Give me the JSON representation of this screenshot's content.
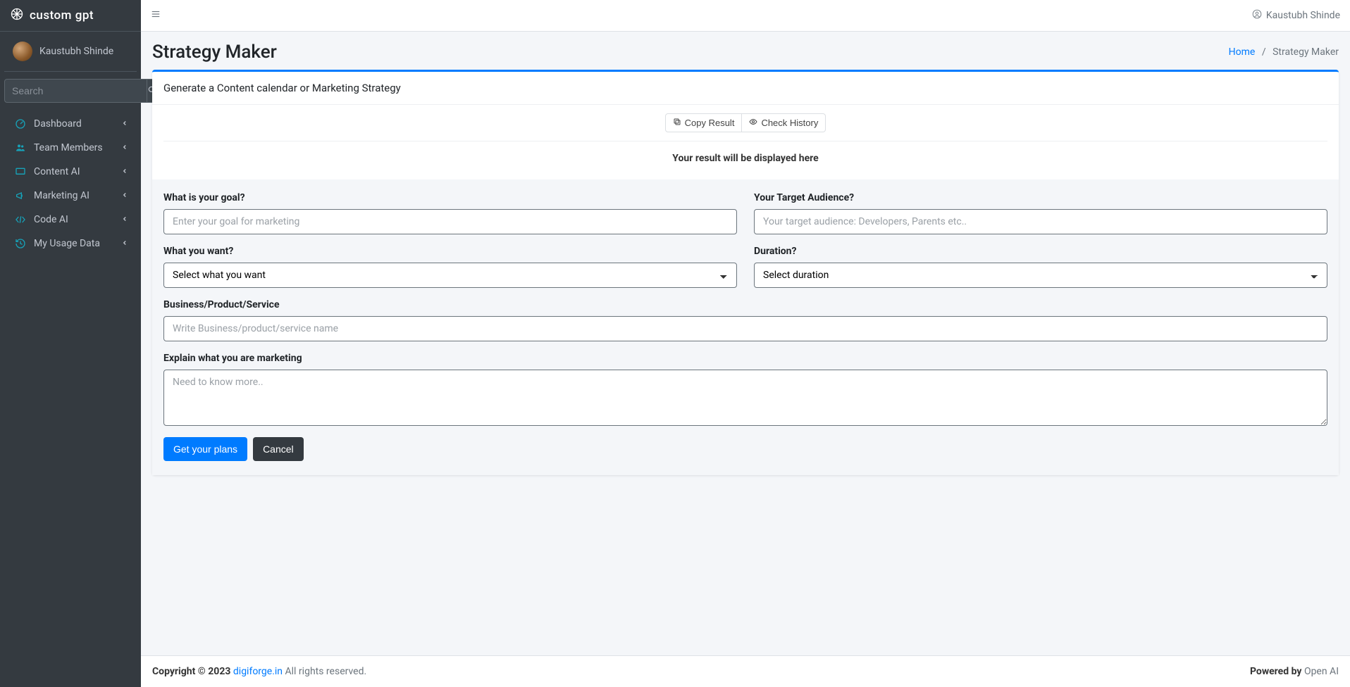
{
  "brand": {
    "name": "custom gpt"
  },
  "sidebar": {
    "user": "Kaustubh Shinde",
    "search_placeholder": "Search",
    "items": [
      {
        "label": "Dashboard"
      },
      {
        "label": "Team Members"
      },
      {
        "label": "Content AI"
      },
      {
        "label": "Marketing AI"
      },
      {
        "label": "Code AI"
      },
      {
        "label": "My Usage Data"
      }
    ]
  },
  "topbar": {
    "user": "Kaustubh Shinde"
  },
  "header": {
    "title": "Strategy Maker",
    "breadcrumb": {
      "home": "Home",
      "current": "Strategy Maker"
    }
  },
  "card": {
    "title": "Generate a Content calendar or Marketing Strategy",
    "copy_btn": "Copy Result",
    "history_btn": "Check History",
    "result_placeholder": "Your result will be displayed here"
  },
  "form": {
    "goal_label": "What is your goal?",
    "goal_placeholder": "Enter your goal for marketing",
    "audience_label": "Your Target Audience?",
    "audience_placeholder": "Your target audience: Developers, Parents etc..",
    "want_label": "What you want?",
    "want_option": "Select what you want",
    "duration_label": "Duration?",
    "duration_option": "Select duration",
    "business_label": "Business/Product/Service",
    "business_placeholder": "Write Business/product/service name",
    "explain_label": "Explain what you are marketing",
    "explain_placeholder": "Need to know more..",
    "submit": "Get your plans",
    "cancel": "Cancel"
  },
  "footer": {
    "copyright_prefix": "Copyright © 2023 ",
    "link": "digiforge.in",
    "copyright_suffix": " All rights reserved.",
    "powered_label": "Powered by ",
    "powered_by": "Open AI"
  }
}
